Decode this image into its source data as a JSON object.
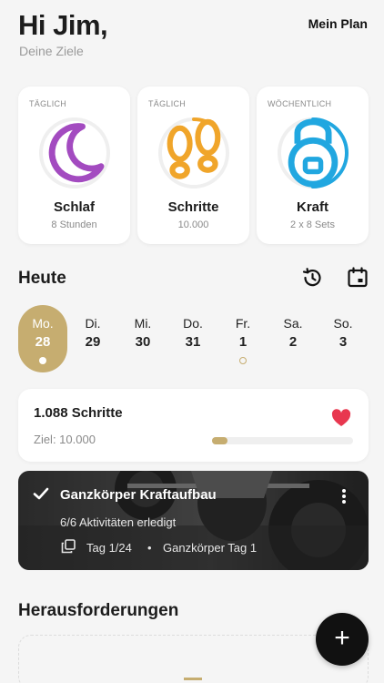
{
  "header": {
    "greeting": "Hi Jim,",
    "subtitle": "Deine Ziele",
    "plan_link": "Mein Plan"
  },
  "goals": [
    {
      "frequency": "TÄGLICH",
      "name": "Schlaf",
      "detail": "8 Stunden",
      "icon": "moon-icon",
      "color": "#a34bc0",
      "progress": 0
    },
    {
      "frequency": "TÄGLICH",
      "name": "Schritte",
      "detail": "10.000",
      "icon": "footprints-icon",
      "color": "#f0a52a",
      "progress": 0.11
    },
    {
      "frequency": "WÖCHENTLICH",
      "name": "Kraft",
      "detail": "2 x 8 Sets",
      "icon": "kettlebell-icon",
      "color": "#21a7e0",
      "progress": 0.5
    }
  ],
  "today": {
    "title": "Heute",
    "history_icon": "history-icon",
    "calendar_icon": "calendar-icon",
    "days": [
      {
        "name": "Mo.",
        "num": "28",
        "selected": true,
        "marker": "dot"
      },
      {
        "name": "Di.",
        "num": "29",
        "selected": false,
        "marker": "none"
      },
      {
        "name": "Mi.",
        "num": "30",
        "selected": false,
        "marker": "none"
      },
      {
        "name": "Do.",
        "num": "31",
        "selected": false,
        "marker": "none"
      },
      {
        "name": "Fr.",
        "num": "1",
        "selected": false,
        "marker": "ring"
      },
      {
        "name": "Sa.",
        "num": "2",
        "selected": false,
        "marker": "none"
      },
      {
        "name": "So.",
        "num": "3",
        "selected": false,
        "marker": "none"
      }
    ]
  },
  "steps": {
    "value": "1.088 Schritte",
    "goal": "Ziel: 10.000",
    "progress": 0.11,
    "icon": "heart-icon",
    "accent": "#e8374f"
  },
  "workout": {
    "title": "Ganzkörper Kraftaufbau",
    "subtitle": "6/6 Aktivitäten erledigt",
    "day": "Tag 1/24",
    "separator": "•",
    "plan_day": "Ganzkörper Tag 1"
  },
  "challenges": {
    "title": "Herausforderungen",
    "fab_label": "+"
  },
  "colors": {
    "accent_gold": "#c6ad70",
    "background": "#f5f5f5"
  }
}
